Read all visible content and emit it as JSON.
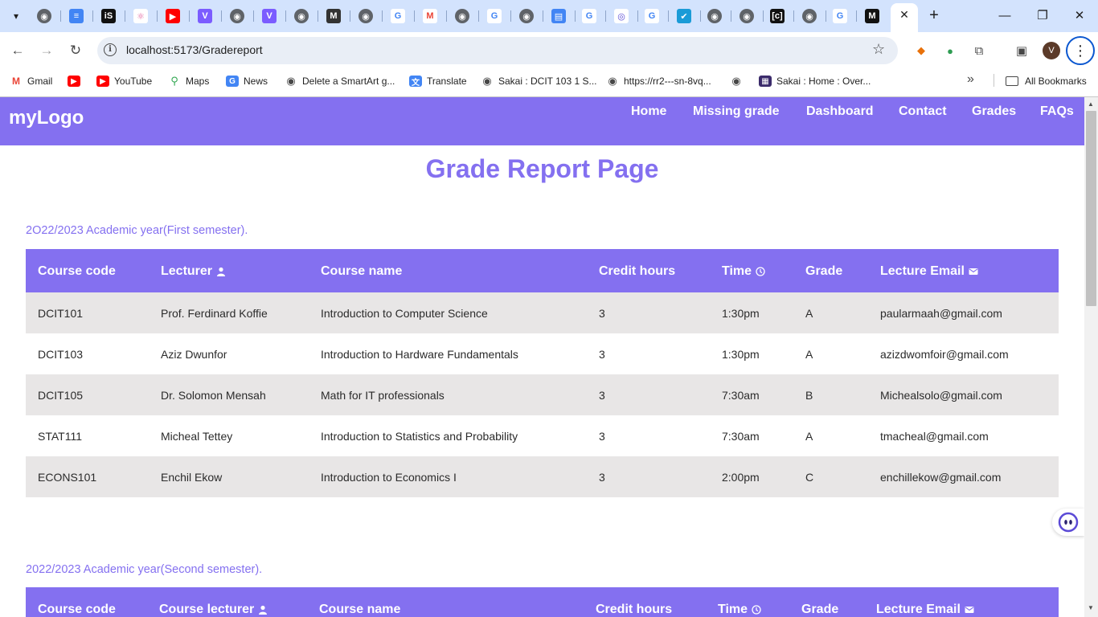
{
  "browser": {
    "url": "localhost:5173/Gradereport",
    "tab_close_glyph": "✕",
    "new_tab_glyph": "+",
    "avatar_initial": "V",
    "bookmarks": [
      {
        "label": "Gmail",
        "icon": "gmail-icon",
        "color": "#ea4335"
      },
      {
        "label": "",
        "icon": "youtube-icon",
        "color": "#ff0000"
      },
      {
        "label": "YouTube",
        "icon": "youtube-icon",
        "color": "#ff0000"
      },
      {
        "label": "Maps",
        "icon": "maps-icon",
        "color": "#34a853"
      },
      {
        "label": "News",
        "icon": "news-icon",
        "color": "#4285f4"
      },
      {
        "label": "Delete a SmartArt g...",
        "icon": "globe-icon",
        "color": "#474747"
      },
      {
        "label": "Translate",
        "icon": "translate-icon",
        "color": "#4285f4"
      },
      {
        "label": "Sakai : DCIT 103 1 S...",
        "icon": "globe-icon",
        "color": "#474747"
      },
      {
        "label": "https://rr2---sn-8vq...",
        "icon": "globe-icon",
        "color": "#474747"
      },
      {
        "label": "",
        "icon": "globe-icon",
        "color": "#474747"
      },
      {
        "label": "Sakai : Home : Over...",
        "icon": "sakai-icon",
        "color": "#3b2b6b"
      }
    ],
    "all_bookmarks_label": "All Bookmarks"
  },
  "site": {
    "logo": "myLogo",
    "nav": [
      "Home",
      "Missing grade",
      "Dashboard",
      "Contact",
      "Grades",
      "FAQs"
    ],
    "title": "Grade Report Page",
    "accent_color": "#8470f0",
    "row_shade_color": "#e8e6e6"
  },
  "semesters": [
    {
      "label": "2O22/2023 Academic year(First semester).",
      "headers": [
        "Course code",
        "Lecturer",
        "Course name",
        "Credit hours",
        "Time",
        "Grade",
        "Lecture Email"
      ],
      "rows": [
        [
          "DCIT101",
          "Prof. Ferdinard Koffie",
          "Introduction to Computer Science",
          "3",
          "1:30pm",
          "A",
          "paularmaah@gmail.com"
        ],
        [
          "DCIT103",
          "Aziz Dwunfor",
          "Introduction to Hardware Fundamentals",
          "3",
          "1:30pm",
          "A",
          "azizdwomfoir@gmail.com"
        ],
        [
          "DCIT105",
          "Dr. Solomon Mensah",
          "Math for IT professionals",
          "3",
          "7:30am",
          "B",
          "Michealsolo@gmail.com"
        ],
        [
          "STAT111",
          "Micheal Tettey",
          "Introduction to Statistics and Probability",
          "3",
          "7:30am",
          "A",
          "tmacheal@gmail.com"
        ],
        [
          "ECONS101",
          "Enchil Ekow",
          "Introduction to Economics I",
          "3",
          "2:00pm",
          "C",
          "enchillekow@gmail.com"
        ]
      ]
    },
    {
      "label": "2022/2023 Academic year(Second semester).",
      "headers": [
        "Course code",
        "Course lecturer",
        "Course name",
        "Credit hours",
        "Time",
        "Grade",
        "Lecture Email"
      ],
      "rows": []
    }
  ]
}
